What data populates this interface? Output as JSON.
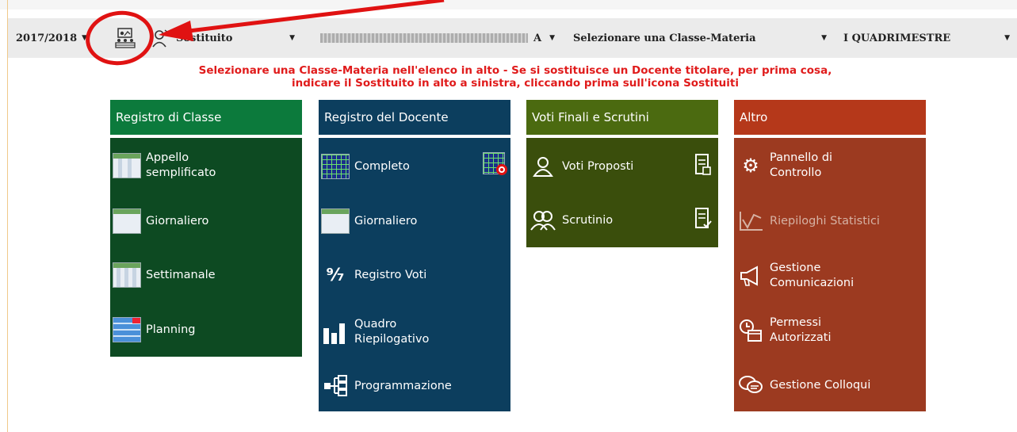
{
  "toolbar": {
    "year": "2017/2018",
    "substitute_label": "Sostituito",
    "teacher_suffix": "A",
    "class_subject_select": "Selezionare una Classe-Materia",
    "period": "I QUADRIMESTRE"
  },
  "notice": {
    "line1": "Selezionare una Classe-Materia nell'elenco in alto - Se si sostituisce un Docente titolare, per prima cosa,",
    "line2": "indicare il Sostituito in alto a sinistra, cliccando prima sull'icona Sostituiti"
  },
  "panels": {
    "registro_classe": {
      "title": "Registro di Classe",
      "color": "#0c7a3c",
      "body_color": "#0d4a22",
      "items": [
        {
          "label": "Appello semplificato",
          "icon": "roll-call-icon"
        },
        {
          "label": "Giornaliero",
          "icon": "daily-sheet-icon"
        },
        {
          "label": "Settimanale",
          "icon": "weekly-sheet-icon"
        },
        {
          "label": "Planning",
          "icon": "planning-icon"
        }
      ]
    },
    "registro_docente": {
      "title": "Registro del Docente",
      "color": "#0c3e5e",
      "body_color": "#0c3e5e",
      "items": [
        {
          "label": "Completo",
          "icon": "full-register-icon"
        },
        {
          "label": "Giornaliero",
          "icon": "daily-sheet-icon"
        },
        {
          "label": "Registro Voti",
          "icon": "grades-icon"
        },
        {
          "label": "Quadro Riepilogativo",
          "icon": "summary-bars-icon"
        },
        {
          "label": "Programmazione",
          "icon": "planning-tree-icon"
        }
      ]
    },
    "voti_finali": {
      "title": "Voti Finali e Scrutini",
      "color": "#4b6a10",
      "body_color": "#3a4e0c",
      "items": [
        {
          "label": "Voti Proposti",
          "icon": "user-icon"
        },
        {
          "label": "Scrutinio",
          "icon": "users-icon"
        }
      ]
    },
    "altro": {
      "title": "Altro",
      "color": "#b5381a",
      "body_color": "#9c3a20",
      "items": [
        {
          "label": "Pannello di Controllo",
          "icon": "gears-icon"
        },
        {
          "label": "Riepiloghi Statistici",
          "icon": "stats-icon"
        },
        {
          "label": "Gestione Comunicazioni",
          "icon": "megaphone-icon"
        },
        {
          "label": "Permessi Autorizzati",
          "icon": "clock-calendar-icon"
        },
        {
          "label": "Gestione Colloqui",
          "icon": "chat-icon"
        }
      ]
    }
  }
}
